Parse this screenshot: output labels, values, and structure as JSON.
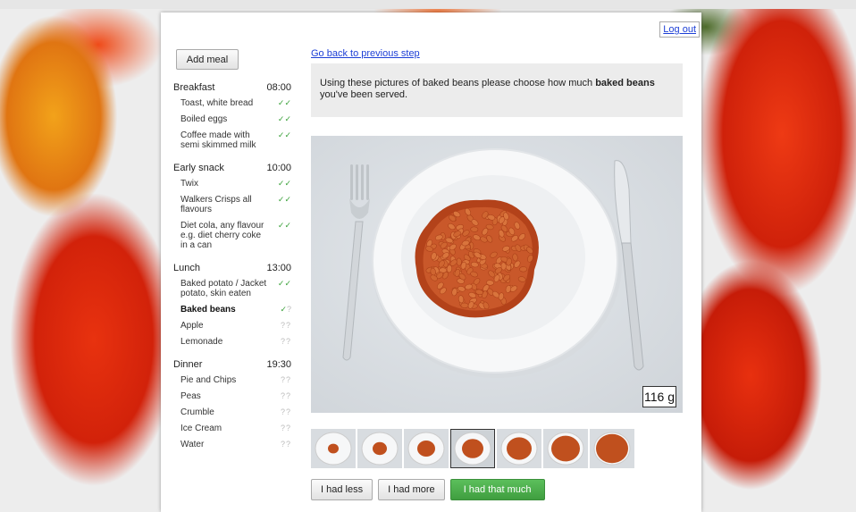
{
  "header": {
    "logout_label": "Log out"
  },
  "sidebar": {
    "add_meal_label": "Add meal",
    "meals": [
      {
        "name": "Breakfast",
        "time": "08:00",
        "foods": [
          {
            "name": "Toast, white bread",
            "status": "done"
          },
          {
            "name": "Boiled eggs",
            "status": "done"
          },
          {
            "name": "Coffee made with semi skimmed milk",
            "status": "done"
          }
        ]
      },
      {
        "name": "Early snack",
        "time": "10:00",
        "foods": [
          {
            "name": "Twix",
            "status": "done"
          },
          {
            "name": "Walkers Crisps all flavours",
            "status": "done"
          },
          {
            "name": "Diet cola, any flavour e.g. diet cherry coke in a can",
            "status": "done"
          }
        ]
      },
      {
        "name": "Lunch",
        "time": "13:00",
        "foods": [
          {
            "name": "Baked potato / Jacket potato, skin eaten",
            "status": "done"
          },
          {
            "name": "Baked beans",
            "status": "partial",
            "bold": true
          },
          {
            "name": "Apple",
            "status": "pending"
          },
          {
            "name": "Lemonade",
            "status": "pending"
          }
        ]
      },
      {
        "name": "Dinner",
        "time": "19:30",
        "foods": [
          {
            "name": "Pie and Chips",
            "status": "pending"
          },
          {
            "name": "Peas",
            "status": "pending"
          },
          {
            "name": "Crumble",
            "status": "pending"
          },
          {
            "name": "Ice Cream",
            "status": "pending"
          },
          {
            "name": "Water",
            "status": "pending"
          }
        ]
      }
    ]
  },
  "main": {
    "back_link": "Go back to previous step",
    "prompt_before": "Using these pictures of baked beans please choose how much ",
    "prompt_bold": "baked beans",
    "prompt_after": " you've been served.",
    "portion_weight": "116 g",
    "thumbnails": {
      "count": 7,
      "selected_index": 3
    },
    "buttons": {
      "less": "I had less",
      "more": "I had more",
      "confirm": "I had that much"
    }
  },
  "colors": {
    "accent_green": "#4cae4c",
    "link_blue": "#1d3fd6",
    "beans": "#c0501e"
  },
  "icons": {
    "done": "check-check-icon",
    "pending": "question-question-icon",
    "partial": "check-question-icon"
  }
}
